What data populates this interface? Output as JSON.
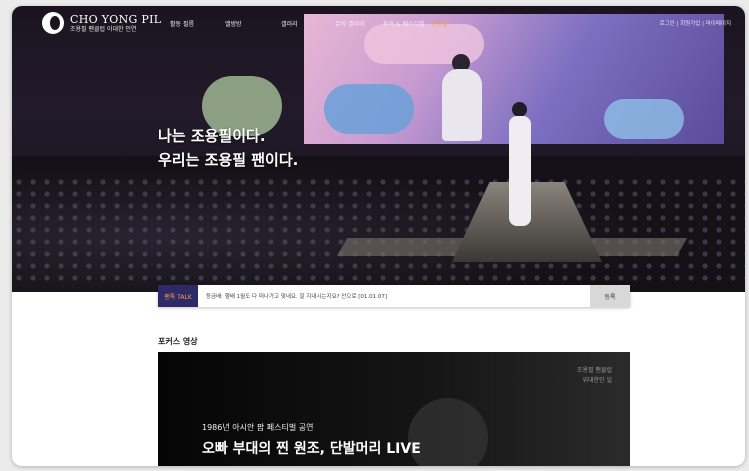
{
  "header": {
    "logo_title": "CHO YONG PIL",
    "logo_sub": "조용필 팬클럽 이대한 인연",
    "nav": [
      "활동 필름",
      "앨범방",
      "갤러리",
      "뮤직 갤러리",
      "투어 & 페스티벌",
      "조용필"
    ],
    "active_nav_index": 5,
    "util_links": "로그인 | 회원가입 | 마이페이지"
  },
  "hero": {
    "line1": "나는 조용필이다.",
    "line2": "우리는 조용필 팬이다."
  },
  "talk": {
    "label": "팬톡 TALK",
    "text": "등금배: 행배 1월도 다 떠나가고 맞네요. 잘 지내시는지요? 안으로 [01.01.07]",
    "button": "등록"
  },
  "focus": {
    "title": "포커스 영상",
    "caption_line1": "조용필 팬클럽",
    "caption_line2": "위대한인 일",
    "subtitle": "1986년 아시안 팝 페스티벌 공연",
    "headline": "오빠 부대의 찐 원조, 단발머리 LIVE"
  },
  "colors": {
    "accent": "#f2a24a",
    "talk_label_bg": "#2e2a66"
  }
}
